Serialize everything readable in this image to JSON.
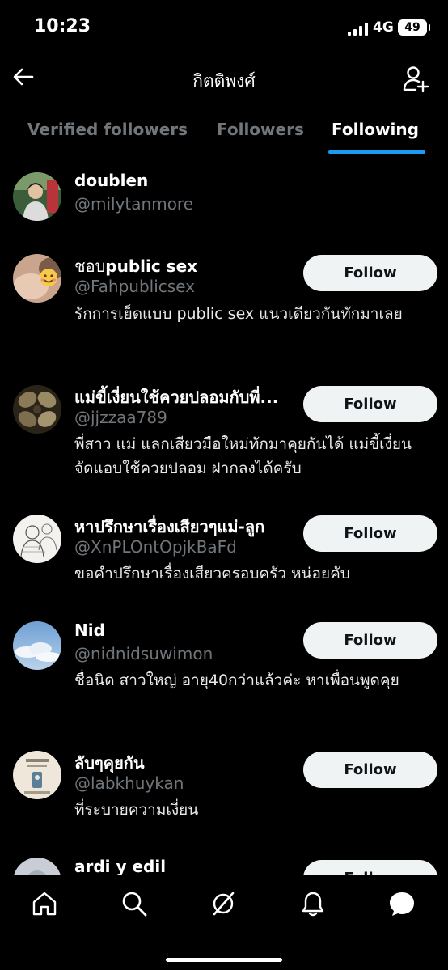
{
  "status": {
    "time": "10:23",
    "network": "4G",
    "battery": "49"
  },
  "header": {
    "title": "กิตติพงศ์"
  },
  "tabs": [
    {
      "label": "Verified followers"
    },
    {
      "label": "Followers"
    },
    {
      "label": "Following",
      "active": true
    }
  ],
  "follow_label": "Follow",
  "users": [
    {
      "name": "doublen",
      "handle": "@milytanmore",
      "bio": ""
    },
    {
      "name_prefix": "ชอบ",
      "name": "public sex",
      "handle": "@Fahpublicsex",
      "bio": "รักการเย็ดแบบ public sex แนวเดียวกันทักมาเลย"
    },
    {
      "name": "แม่ขี้เงี่ยนใช้ควยปลอมกับพี่...",
      "handle": "@jjzzaa789",
      "bio": "พี่สาว แม่ แลกเสียวมือใหม่ทักมาคุยกันได้ แม่ขี้เงี่ยนจัดแอบใช้ควยปลอม ฝากลงได้ครับ"
    },
    {
      "name": "หาปรึกษาเรื่องเสียวๆแม่-ลูก",
      "handle": "@XnPLOntOpjkBaFd",
      "bio": "ขอคำปรึกษาเรื่องเสียวครอบครัว หน่อยคับ"
    },
    {
      "name": "Nid",
      "handle": "@nidnidsuwimon",
      "bio": "ชื่อนิด สาวใหญ่ อายุ40กว่าแล้วค่ะ หาเพื่อนพูดคุย"
    },
    {
      "name": "ลับๆคุยกัน",
      "handle": "@labkhuykan",
      "bio": "ที่ระบายความเงี่ยน"
    },
    {
      "name": "ardi y edil",
      "handle": "",
      "bio": ""
    }
  ],
  "colors": {
    "accent": "#1d9bf0",
    "background": "#000000",
    "muted": "#71767b",
    "button": "#eff3f4"
  }
}
